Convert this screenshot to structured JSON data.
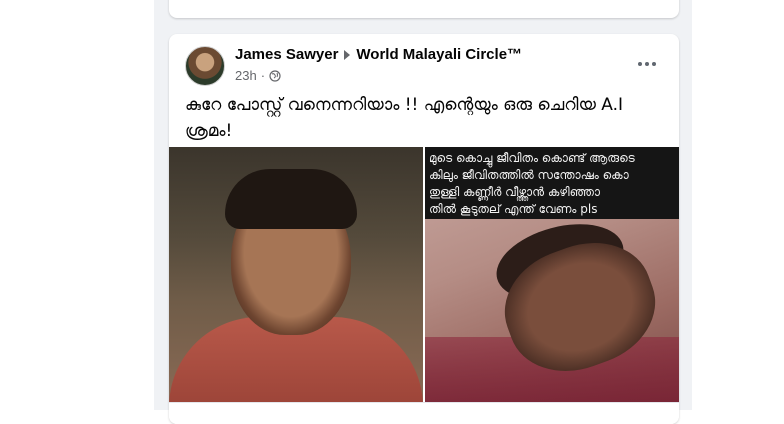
{
  "post": {
    "author": "James Sawyer",
    "group": "World Malayali Circle™",
    "time": "23h",
    "separator": "·",
    "privacy_icon": "globe-icon",
    "text": "കുറേ പോസ്റ്റ് വനെന്നറിയാം !! എന്റെയും ഒരു ചെറിയ A.I ശ്രമം!",
    "more_icon": "more-options-icon"
  },
  "images": {
    "left": {
      "description_icon": "photo-man-portrait"
    },
    "right": {
      "overlay_lines": [
        "മുടെ കൊച്ചു ജീവിതം കൊണ്ട് ആരുടെ",
        "കിലും ജീവിതത്തിൽ സന്തോഷം കൊ",
        " തുള്ളി കണ്ണീർ വീഴ്ത്താൻ കഴിഞ്ഞാ",
        "തിൽ കൂടുതല് എന്ത് വേണം pls"
      ]
    }
  },
  "colors": {
    "feed_background": "#f0f2f5",
    "card_background": "#ffffff",
    "author_text": "#050505",
    "meta_text": "#65676b"
  }
}
